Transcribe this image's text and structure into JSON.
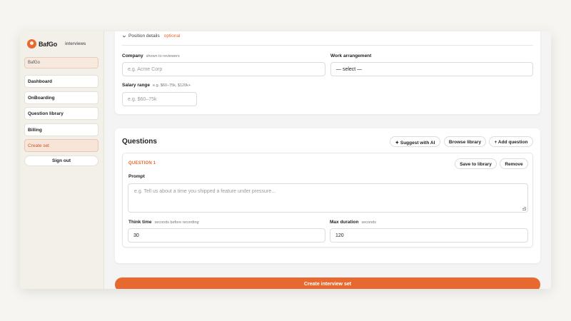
{
  "brand": {
    "name": "BafGo",
    "tag": "interviews",
    "accent": "#e8692f"
  },
  "sidebar": {
    "org": "BafGo",
    "items": [
      {
        "label": "Dashboard"
      },
      {
        "label": "OnBoarding"
      },
      {
        "label": "Question library"
      },
      {
        "label": "Billing"
      },
      {
        "label": "Create set",
        "active": true
      }
    ],
    "sign_out": "Sign out"
  },
  "position": {
    "section_label": "Position details",
    "optional": "optional",
    "company": {
      "label": "Company",
      "hint": "shown to reviewers",
      "placeholder": "e.g. Acme Corp"
    },
    "work_arrangement": {
      "label": "Work arrangement",
      "selected": "— select —"
    },
    "salary": {
      "label": "Salary range",
      "hint": "e.g. $60–75k, $120k+",
      "placeholder": "e.g. $60–75k"
    }
  },
  "questions": {
    "title": "Questions",
    "suggest_label": "✦ Suggest with AI",
    "browse_label": "Browse library",
    "add_label": "+ Add question",
    "items": [
      {
        "number_label": "QUESTION 1",
        "save_label": "Save to library",
        "remove_label": "Remove",
        "prompt_label": "Prompt",
        "prompt_placeholder": "e.g. Tell us about a time you shipped a feature under pressure...",
        "think_label": "Think time",
        "think_hint": "seconds before recording",
        "think_value": "30",
        "max_label": "Max duration",
        "max_hint": "seconds",
        "max_value": "120"
      }
    ]
  },
  "create_label": "Create interview set"
}
